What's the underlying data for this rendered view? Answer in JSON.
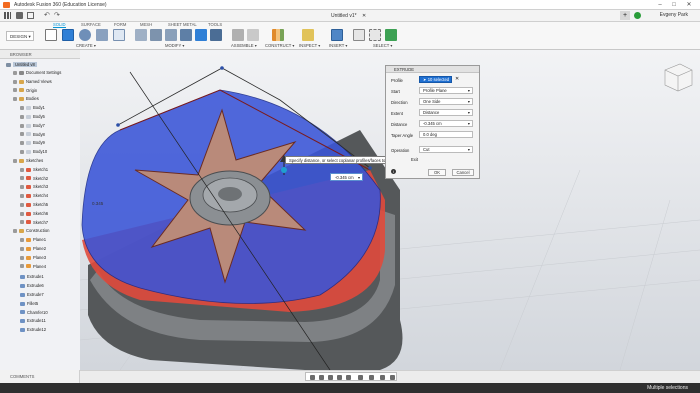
{
  "window": {
    "title": "Autodesk Fusion 360 (Education License)"
  },
  "tabbar": {
    "doc_tab": "Untitled v1*",
    "user": "Evgeny Park"
  },
  "ribbon": {
    "tabs": [
      "SOLID",
      "SURFACE",
      "FORM",
      "MESH",
      "SHEET METAL",
      "TOOLS"
    ],
    "active_tab": "SOLID",
    "workspace": "DESIGN ▾",
    "groups": [
      "CREATE ▾",
      "MODIFY ▾",
      "ASSEMBLE ▾",
      "CONSTRUCT ▾",
      "INSPECT ▾",
      "INSERT ▾",
      "SELECT ▾"
    ]
  },
  "browser": {
    "title": "BROWSER",
    "root": "Untitled v8",
    "items": [
      {
        "label": "Document Settings",
        "icon": "gear-icon",
        "indent": 1
      },
      {
        "label": "Named Views",
        "icon": "folder-icon",
        "indent": 1
      },
      {
        "label": "Origin",
        "icon": "folder-icon",
        "indent": 1
      },
      {
        "label": "Bodies",
        "icon": "folder-icon",
        "indent": 1
      },
      {
        "label": "Body1",
        "icon": "body-icon",
        "indent": 2
      },
      {
        "label": "Body5",
        "icon": "body-icon",
        "indent": 2
      },
      {
        "label": "Body7",
        "icon": "body-icon",
        "indent": 2
      },
      {
        "label": "Body8",
        "icon": "body-icon",
        "indent": 2
      },
      {
        "label": "Body9",
        "icon": "body-icon",
        "indent": 2
      },
      {
        "label": "Body10",
        "icon": "body-icon",
        "indent": 2
      },
      {
        "label": "Sketches",
        "icon": "folder-icon",
        "indent": 1
      },
      {
        "label": "Sketch1",
        "icon": "sketch-icon",
        "indent": 2
      },
      {
        "label": "Sketch2",
        "icon": "sketch-icon",
        "indent": 2
      },
      {
        "label": "Sketch3",
        "icon": "sketch-icon",
        "indent": 2
      },
      {
        "label": "Sketch4",
        "icon": "sketch-icon",
        "indent": 2
      },
      {
        "label": "Sketch5",
        "icon": "sketch-icon",
        "indent": 2
      },
      {
        "label": "Sketch6",
        "icon": "sketch-icon",
        "indent": 2
      },
      {
        "label": "Sketch7",
        "icon": "sketch-icon",
        "indent": 2
      },
      {
        "label": "Construction",
        "icon": "folder-icon",
        "indent": 1
      },
      {
        "label": "Plane1",
        "icon": "plane-icon",
        "indent": 2
      },
      {
        "label": "Plane2",
        "icon": "plane-icon",
        "indent": 2
      },
      {
        "label": "Plane3",
        "icon": "plane-icon",
        "indent": 2
      },
      {
        "label": "Plane4",
        "icon": "plane-icon",
        "indent": 2
      }
    ],
    "timeline": [
      "Extrude1",
      "Extrude6",
      "Extrude7",
      "Fillet5",
      "Chamfer10",
      "Extrude11",
      "Extrude12"
    ]
  },
  "extrude_dialog": {
    "title": "EXTRUDE",
    "profile_label": "Profile",
    "profile_value": "10 selected",
    "rows": [
      {
        "label": "Start",
        "value": "Profile Plane"
      },
      {
        "label": "Direction",
        "value": "One Side"
      },
      {
        "label": "Extent",
        "value": "Distance"
      },
      {
        "label": "Distance",
        "value": "-0.345 cm"
      },
      {
        "label": "Taper Angle",
        "value": "0.0 deg"
      },
      {
        "label": "Operation",
        "value": "Cut"
      }
    ],
    "ok_label": "OK",
    "cancel_label": "Cancel",
    "exit_label": "Exit"
  },
  "canvas": {
    "tooltip": "Specify distance, or select coplanar profiles/faces to modify the selection.",
    "distance_input": "-0.345 cm",
    "dim_label": "0.345"
  },
  "comments_label": "COMMENTS",
  "status": "Multiple selections",
  "colors": {
    "accent": "#0696d7",
    "blue_body": "#3a55d8",
    "red_cut": "#e04a3c",
    "dark_body": "#55585a"
  }
}
